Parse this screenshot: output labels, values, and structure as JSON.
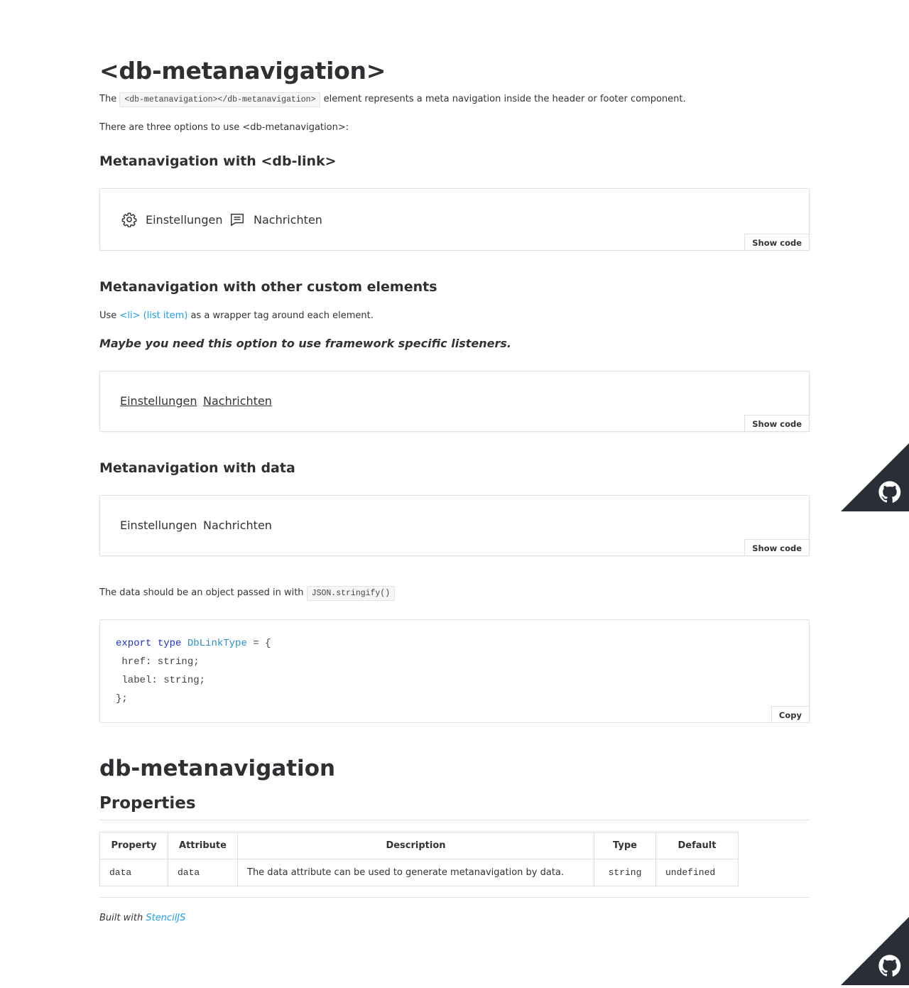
{
  "page_title": "<db-metanavigation>",
  "intro": {
    "prefix": "The",
    "code": "<db-metanavigation></db-metanavigation>",
    "suffix": "element represents a meta navigation inside the header or footer component."
  },
  "options_text": "There are three options to use <db-metanavigation>:",
  "section1": {
    "heading": "Metanavigation with <db-link>",
    "items": [
      {
        "label": "Einstellungen",
        "icon": "gear-icon"
      },
      {
        "label": "Nachrichten",
        "icon": "chat-icon"
      }
    ],
    "show_code": "Show code"
  },
  "section2": {
    "heading": "Metanavigation with other custom elements",
    "use_prefix": "Use",
    "use_link": "<li> (list item)",
    "use_suffix": "as a wrapper tag around each element.",
    "note": "Maybe you need this option to use framework specific listeners.",
    "items": [
      "Einstellungen",
      "Nachrichten"
    ],
    "show_code": "Show code"
  },
  "section3": {
    "heading": "Metanavigation with data",
    "items": [
      "Einstellungen",
      "Nachrichten"
    ],
    "show_code": "Show code"
  },
  "data_note": {
    "prefix": "The data should be an object passed in with",
    "code": "JSON.stringify()"
  },
  "code_sample": {
    "kw_export": "export",
    "kw_type": "type",
    "type_name": "DbLinkType",
    "open": " = {",
    "line2": " href: string;",
    "line3": " label: string;",
    "line4": "};",
    "copy_label": "Copy"
  },
  "component_heading": "db-metanavigation",
  "properties_heading": "Properties",
  "table": {
    "headers": [
      "Property",
      "Attribute",
      "Description",
      "Type",
      "Default"
    ],
    "rows": [
      [
        "data",
        "data",
        "The data attribute can be used to generate metanavigation by data.",
        "string",
        "undefined"
      ]
    ]
  },
  "footer": {
    "prefix": "Built with",
    "link": "StencilJS"
  },
  "colors": {
    "link": "#1f9ee6",
    "github_corner": "#2a2e36"
  }
}
